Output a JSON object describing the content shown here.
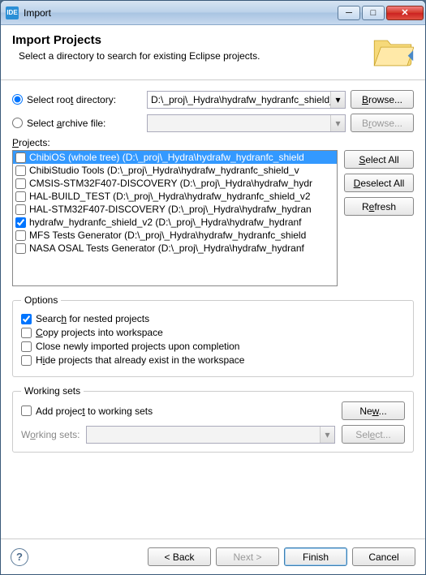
{
  "window": {
    "title": "Import",
    "app_badge": "IDE"
  },
  "banner": {
    "title": "Import Projects",
    "subtitle": "Select a directory to search for existing Eclipse projects."
  },
  "source": {
    "root_label_pre": "Select roo",
    "root_label_key": "t",
    "root_label_post": " directory:",
    "root_value": "D:\\_proj\\_Hydra\\hydrafw_hydranfc_shield_v",
    "archive_label_pre": "Select ",
    "archive_label_key": "a",
    "archive_label_post": "rchive file:",
    "browse1": "Browse...",
    "browse2": "Browse...",
    "selected": "root"
  },
  "projects_label": "Projects:",
  "projects": [
    {
      "checked": false,
      "selected": true,
      "label": "ChibiOS (whole tree) (D:\\_proj\\_Hydra\\hydrafw_hydranfc_shield"
    },
    {
      "checked": false,
      "selected": false,
      "label": "ChibiStudio Tools (D:\\_proj\\_Hydra\\hydrafw_hydranfc_shield_v"
    },
    {
      "checked": false,
      "selected": false,
      "label": "CMSIS-STM32F407-DISCOVERY (D:\\_proj\\_Hydra\\hydrafw_hydr"
    },
    {
      "checked": false,
      "selected": false,
      "label": "HAL-BUILD_TEST (D:\\_proj\\_Hydra\\hydrafw_hydranfc_shield_v2"
    },
    {
      "checked": false,
      "selected": false,
      "label": "HAL-STM32F407-DISCOVERY (D:\\_proj\\_Hydra\\hydrafw_hydran"
    },
    {
      "checked": true,
      "selected": false,
      "label": "hydrafw_hydranfc_shield_v2 (D:\\_proj\\_Hydra\\hydrafw_hydranf"
    },
    {
      "checked": false,
      "selected": false,
      "label": "MFS Tests Generator (D:\\_proj\\_Hydra\\hydrafw_hydranfc_shield"
    },
    {
      "checked": false,
      "selected": false,
      "label": "NASA OSAL Tests Generator (D:\\_proj\\_Hydra\\hydrafw_hydranf"
    }
  ],
  "side_buttons": {
    "select_all": "Select All",
    "deselect_all": "Deselect All",
    "refresh": "Refresh"
  },
  "options": {
    "legend": "Options",
    "search_nested": "Search for nested projects",
    "search_nested_checked": true,
    "copy": "Copy projects into workspace",
    "close_new": "Close newly imported projects upon completion",
    "hide_existing": "Hide projects that already exist in the workspace"
  },
  "working_sets": {
    "legend": "Working sets",
    "add_label": "Add project to working sets",
    "add_checked": false,
    "new_btn": "New...",
    "ws_label": "Working sets:",
    "select_btn": "Select..."
  },
  "footer": {
    "back": "< Back",
    "next": "Next >",
    "finish": "Finish",
    "cancel": "Cancel"
  }
}
